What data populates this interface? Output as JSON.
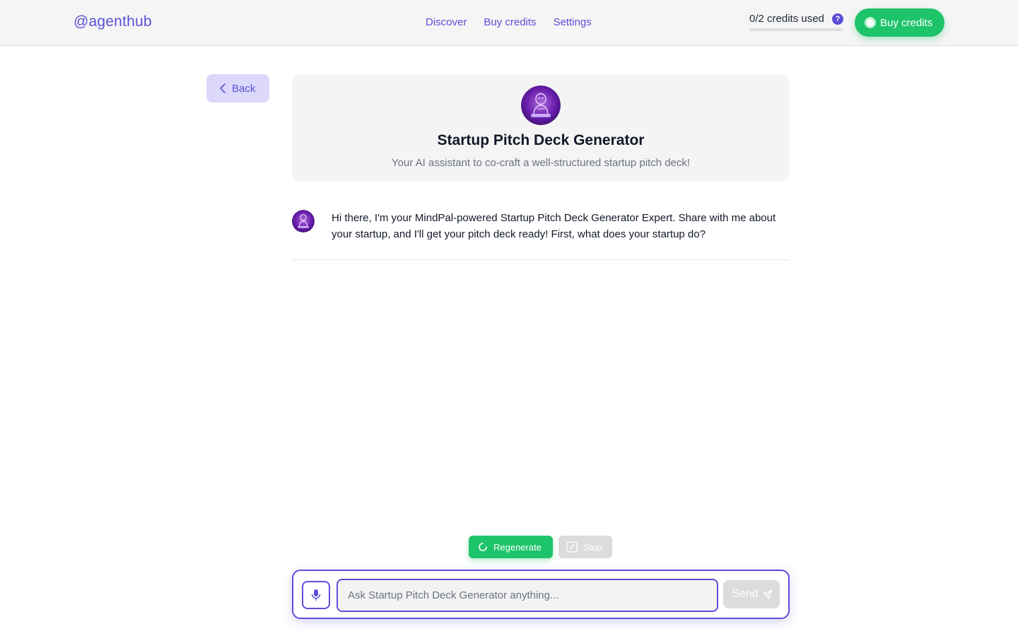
{
  "header": {
    "brand": "@agenthub",
    "nav": [
      {
        "label": "Discover"
      },
      {
        "label": "Buy credits"
      },
      {
        "label": "Settings"
      }
    ],
    "credits_text": "0/2 credits used",
    "help_glyph": "?",
    "credits_used_fraction": 0,
    "buy_button_label": "Buy credits"
  },
  "back_label": "Back",
  "agent": {
    "name": "Startup Pitch Deck Generator",
    "tagline": "Your AI assistant to co-craft a well-structured startup pitch deck!"
  },
  "messages": [
    {
      "role": "assistant",
      "text": "Hi there, I'm your MindPal-powered Startup Pitch Deck Generator Expert. Share with me about your startup, and I'll get your pitch deck ready! First, what does your startup do?"
    }
  ],
  "actions": {
    "regenerate_label": "Regenerate",
    "stop_label": "Stop"
  },
  "composer": {
    "placeholder": "Ask Startup Pitch Deck Generator anything...",
    "value": "",
    "send_label": "Send"
  },
  "icons": {
    "back": "chevron-left-icon",
    "regenerate": "refresh-icon",
    "stop": "stop-icon",
    "mic": "microphone-icon",
    "send": "paper-plane-icon",
    "help": "question-icon"
  },
  "colors": {
    "accent": "#5b4fd6",
    "green": "#1ec46a",
    "disabled": "#dcdcdc"
  }
}
